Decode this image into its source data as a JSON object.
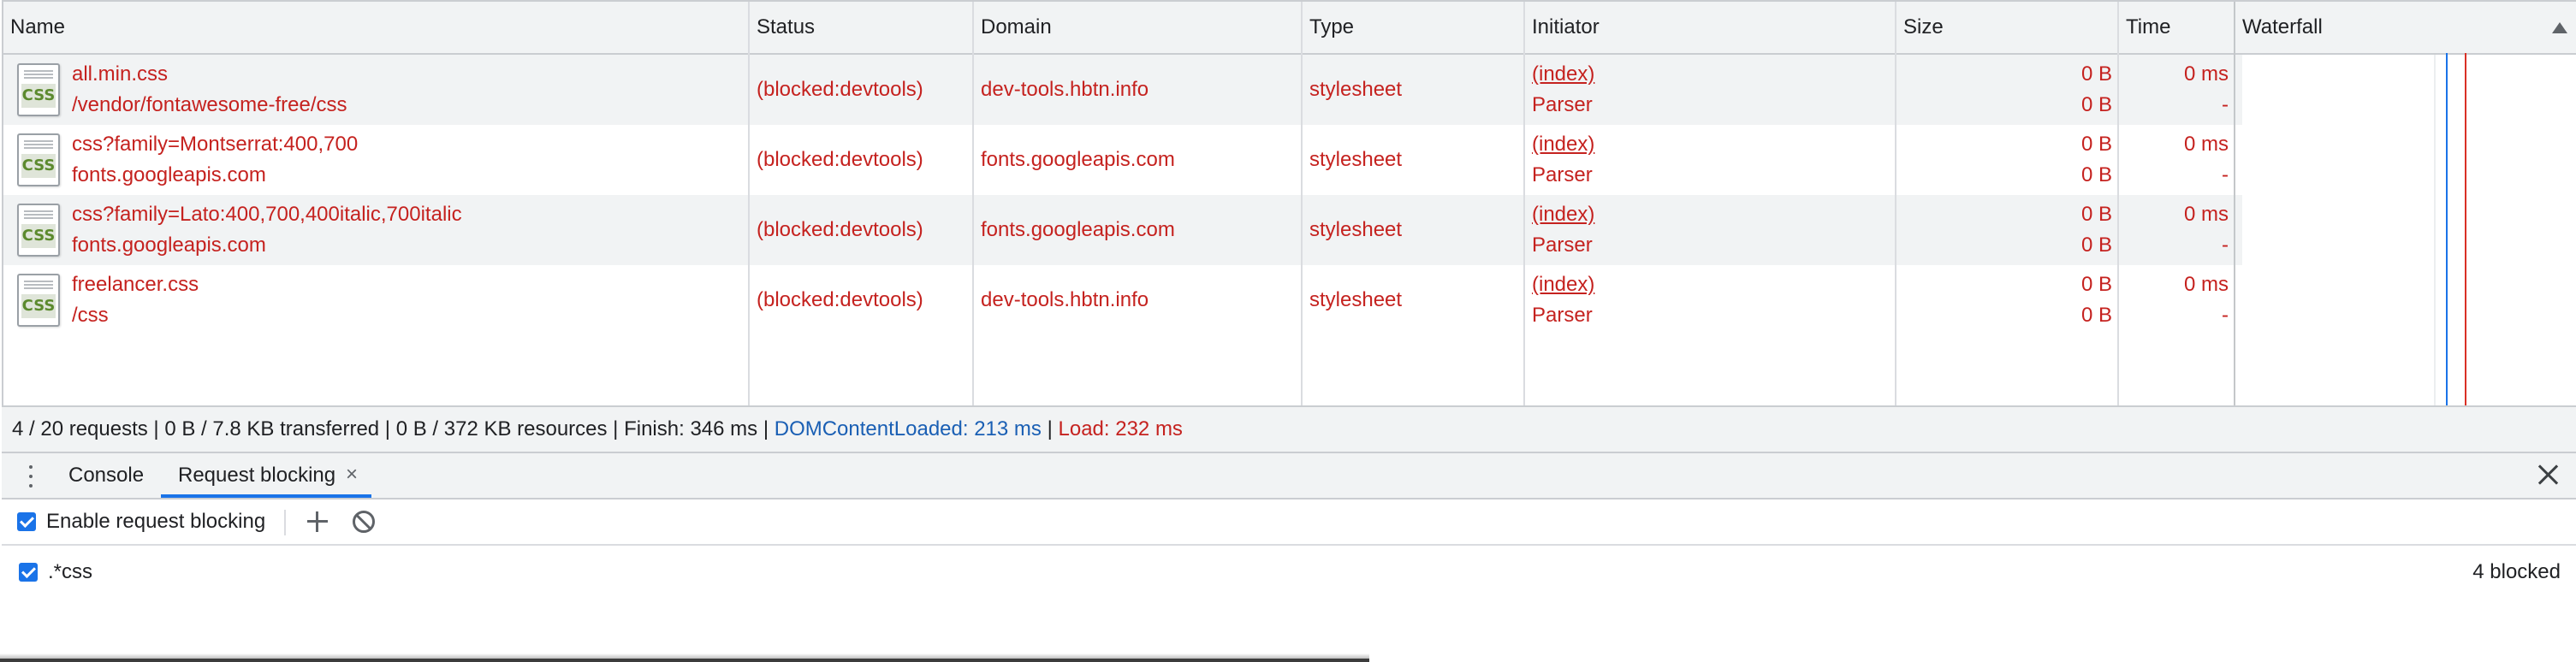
{
  "columns": {
    "name": "Name",
    "status": "Status",
    "domain": "Domain",
    "type": "Type",
    "initiator": "Initiator",
    "size": "Size",
    "time": "Time",
    "waterfall": "Waterfall"
  },
  "requests": [
    {
      "icon_label": "CSS",
      "name": "all.min.css",
      "path": "/vendor/fontawesome-free/css",
      "status": "(blocked:devtools)",
      "domain": "dev-tools.hbtn.info",
      "type": "stylesheet",
      "initiator": "(index)",
      "initiator_type": "Parser",
      "size_transferred": "0 B",
      "size_resource": "0 B",
      "time": "0 ms",
      "latency": "-"
    },
    {
      "icon_label": "CSS",
      "name": "css?family=Montserrat:400,700",
      "path": "fonts.googleapis.com",
      "status": "(blocked:devtools)",
      "domain": "fonts.googleapis.com",
      "type": "stylesheet",
      "initiator": "(index)",
      "initiator_type": "Parser",
      "size_transferred": "0 B",
      "size_resource": "0 B",
      "time": "0 ms",
      "latency": "-"
    },
    {
      "icon_label": "CSS",
      "name": "css?family=Lato:400,700,400italic,700italic",
      "path": "fonts.googleapis.com",
      "status": "(blocked:devtools)",
      "domain": "fonts.googleapis.com",
      "type": "stylesheet",
      "initiator": "(index)",
      "initiator_type": "Parser",
      "size_transferred": "0 B",
      "size_resource": "0 B",
      "time": "0 ms",
      "latency": "-"
    },
    {
      "icon_label": "CSS",
      "name": "freelancer.css",
      "path": "/css",
      "status": "(blocked:devtools)",
      "domain": "dev-tools.hbtn.info",
      "type": "stylesheet",
      "initiator": "(index)",
      "initiator_type": "Parser",
      "size_transferred": "0 B",
      "size_resource": "0 B",
      "time": "0 ms",
      "latency": "-"
    }
  ],
  "summary": {
    "requests": "4 / 20 requests",
    "sep1": " | ",
    "transferred": "0 B / 7.8 KB transferred",
    "sep2": " | ",
    "resources": "0 B / 372 KB resources",
    "sep3": " | ",
    "finish": "Finish: 346 ms",
    "sep4": " | ",
    "dom_content_loaded": "DOMContentLoaded: 213 ms",
    "sep5": " | ",
    "load": "Load: 232 ms"
  },
  "drawer": {
    "tabs": [
      "Console",
      "Request blocking"
    ],
    "active_tab": "Request blocking",
    "tab_close": "×"
  },
  "blocking": {
    "enable_label": "Enable request blocking",
    "enabled": true,
    "patterns": [
      {
        "pattern": ".*css",
        "enabled": true,
        "count": "4 blocked"
      }
    ]
  },
  "colors": {
    "blocked_text": "#c5221f",
    "dom_content_loaded": "#1a5fb4",
    "load": "#c5221f",
    "accent": "#1a73e8"
  }
}
